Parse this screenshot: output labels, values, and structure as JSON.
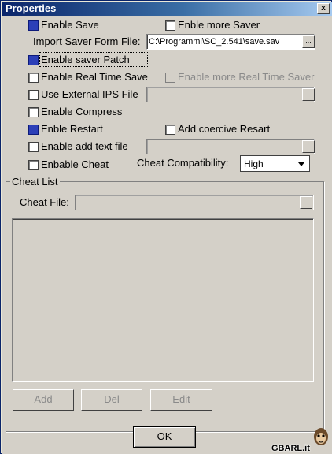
{
  "window": {
    "title": "Properties",
    "close_glyph": "x"
  },
  "options": {
    "enable_save": {
      "label": "Enable Save",
      "checked": true
    },
    "enable_more_saver": {
      "label": "Enble more Saver",
      "checked": false
    },
    "import_saver_label": "Import Saver Form File:",
    "import_saver_value": "C:\\Programmi\\SC_2.541\\save.sav",
    "enable_saver_patch": {
      "label": "Enable saver Patch",
      "checked": true
    },
    "enable_real_time_save": {
      "label": "Enable Real Time Save",
      "checked": false
    },
    "enable_more_real_time_saver": {
      "label": "Enable more Real Time Saver",
      "checked": false,
      "disabled": true
    },
    "use_external_ips": {
      "label": "Use External IPS File",
      "checked": false
    },
    "ips_file_value": "",
    "enable_compress": {
      "label": "Enable Compress",
      "checked": false
    },
    "enable_restart": {
      "label": "Enble Restart",
      "checked": true
    },
    "add_coercive_restart": {
      "label": "Add coercive Resart",
      "checked": false
    },
    "enable_add_text_file": {
      "label": "Enable add text file",
      "checked": false
    },
    "text_file_value": "",
    "enable_cheat": {
      "label": "Enbable Cheat",
      "checked": false
    },
    "cheat_compat_label": "Cheat Compatibility:",
    "cheat_compat_value": "High"
  },
  "cheat_list": {
    "group_label": "Cheat List",
    "file_label": "Cheat File:",
    "file_value": "",
    "add_label": "Add",
    "del_label": "Del",
    "edit_label": "Edit"
  },
  "browse_glyph": "...",
  "ok_label": "OK",
  "watermark": "GBARL.it",
  "colors": {
    "titlebar_start": "#0a246a",
    "titlebar_end": "#a6caf0",
    "checked_fill": "#2c3fb8",
    "dialog_bg": "#d4d0c8"
  }
}
